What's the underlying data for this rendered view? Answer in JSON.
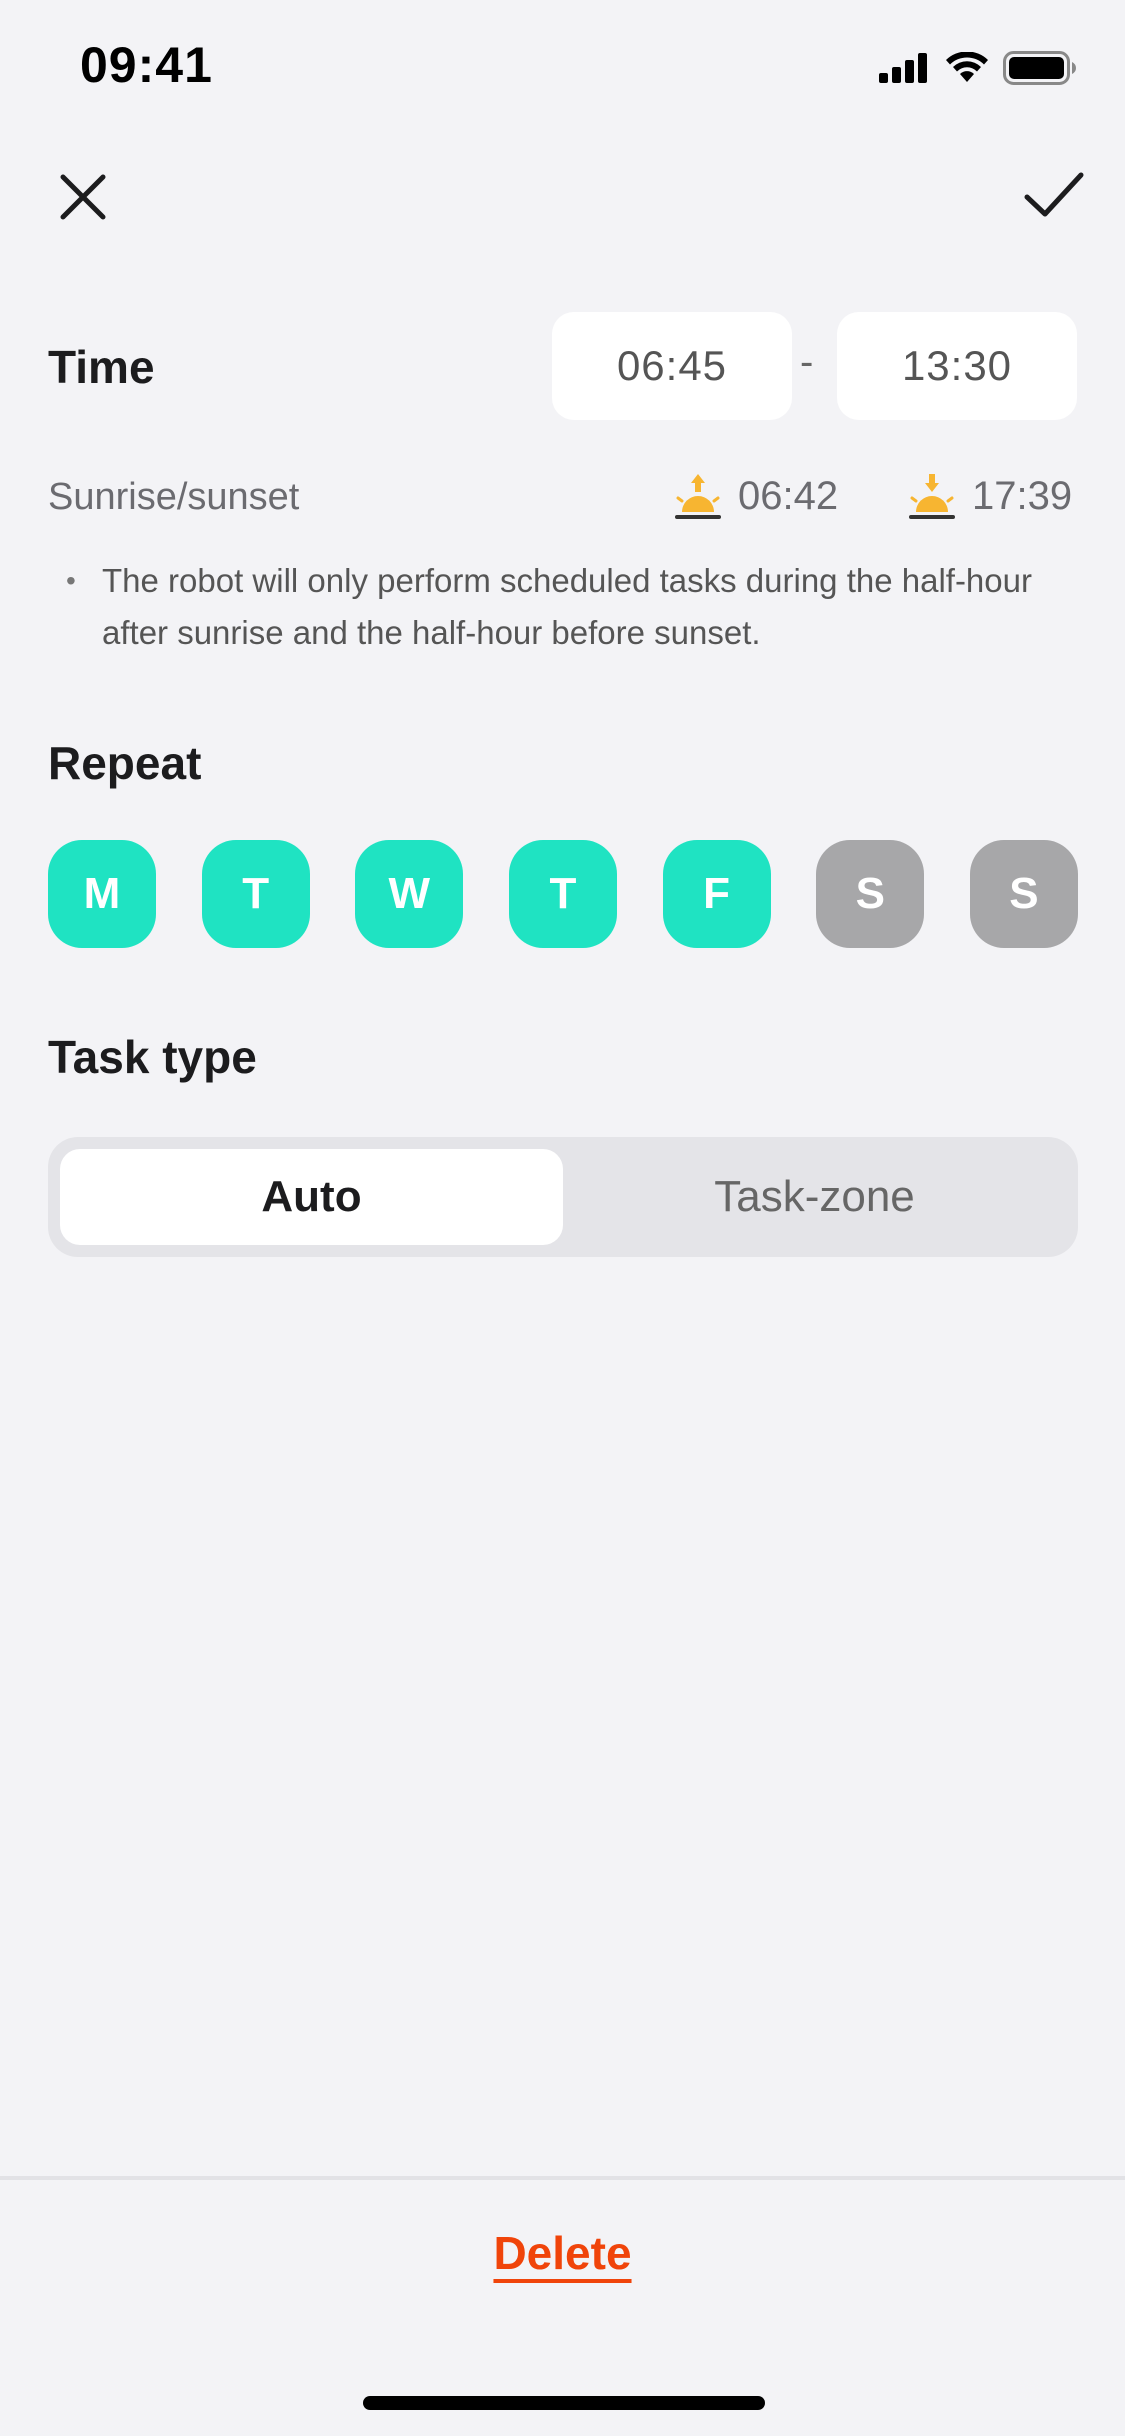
{
  "status_bar": {
    "time": "09:41",
    "icons": [
      "cellular-signal-icon",
      "wifi-icon",
      "battery-icon"
    ]
  },
  "header": {
    "close_icon": "close-icon",
    "confirm_icon": "checkmark-icon"
  },
  "time": {
    "label": "Time",
    "start": "06:45",
    "separator": "-",
    "end": "13:30"
  },
  "sun": {
    "label": "Sunrise/sunset",
    "sunrise_icon": "sunrise-icon",
    "sunrise": "06:42",
    "sunset_icon": "sunset-icon",
    "sunset": "17:39",
    "note": "The robot will only perform scheduled tasks during the half-hour after sunrise and the half-hour before sunset.",
    "icon_color": "#f7b531"
  },
  "repeat": {
    "title": "Repeat",
    "days": [
      {
        "label": "M",
        "selected": true
      },
      {
        "label": "T",
        "selected": true
      },
      {
        "label": "W",
        "selected": true
      },
      {
        "label": "T",
        "selected": true
      },
      {
        "label": "F",
        "selected": true
      },
      {
        "label": "S",
        "selected": false
      },
      {
        "label": "S",
        "selected": false
      }
    ],
    "active_color": "#1fe3c2",
    "inactive_color": "#a7a7a9"
  },
  "task_type": {
    "title": "Task type",
    "options": [
      "Auto",
      "Task-zone"
    ],
    "selected": "Auto"
  },
  "footer": {
    "delete_label": "Delete",
    "delete_color": "#f0440a"
  }
}
